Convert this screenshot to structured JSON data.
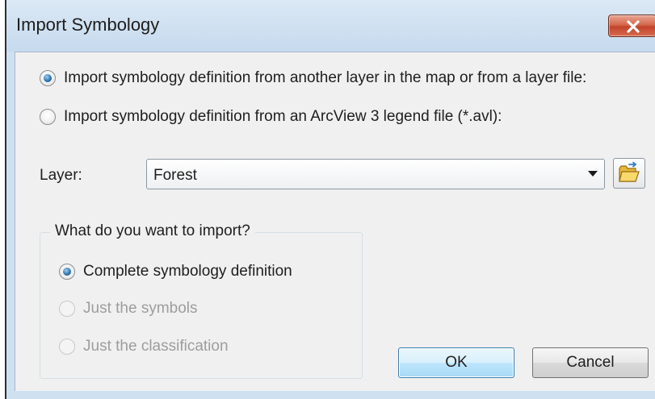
{
  "window": {
    "title": "Import Symbology",
    "close_icon": "close-x-icon"
  },
  "source": {
    "options": [
      {
        "label": "Import symbology definition from another layer in the map or from a layer file:",
        "selected": true
      },
      {
        "label": "Import symbology definition from an ArcView 3 legend file (*.avl):",
        "selected": false
      }
    ]
  },
  "layer": {
    "label": "Layer:",
    "value": "Forest",
    "dropdown_icon": "chevron-down-icon",
    "browse_icon": "open-folder-icon"
  },
  "import": {
    "group_title": "What do you want to import?",
    "options": [
      {
        "label": "Complete symbology definition",
        "selected": true,
        "enabled": true
      },
      {
        "label": "Just the symbols",
        "selected": false,
        "enabled": false
      },
      {
        "label": "Just the classification",
        "selected": false,
        "enabled": false
      }
    ]
  },
  "buttons": {
    "ok": "OK",
    "cancel": "Cancel"
  },
  "colors": {
    "titlebar": "#c6daee",
    "client": "#f0f0f0",
    "close": "#c2432a",
    "default_button_border": "#3c7fb1"
  }
}
